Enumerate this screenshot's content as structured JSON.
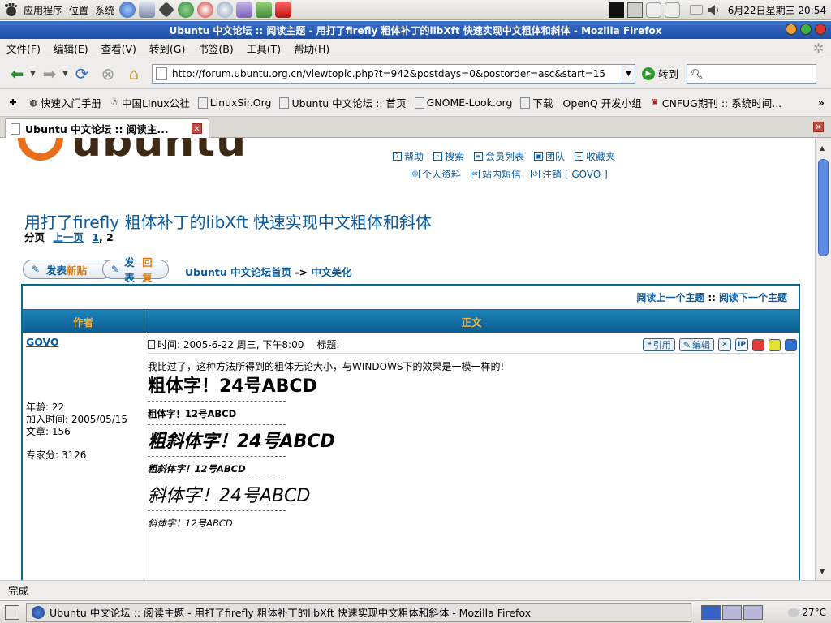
{
  "top_panel": {
    "menus": [
      "应用程序",
      "位置",
      "系统"
    ],
    "clock": "6月22日星期三 20:54"
  },
  "window": {
    "title": "Ubuntu 中文论坛 :: 阅读主题 - 用打了firefly 粗体补丁的libXft 快速实现中文粗体和斜体 - Mozilla Firefox"
  },
  "menubar": {
    "items": [
      "文件(F)",
      "编辑(E)",
      "查看(V)",
      "转到(G)",
      "书签(B)",
      "工具(T)",
      "帮助(H)"
    ]
  },
  "navbar": {
    "url": "http://forum.ubuntu.org.cn/viewtopic.php?t=942&postdays=0&postorder=asc&start=15",
    "go_label": "转到",
    "search_placeholder": ""
  },
  "bookmarks": {
    "items": [
      "快速入门手册",
      "中国Linux公社",
      "LinuxSir.Org",
      "Ubuntu 中文论坛 :: 首页",
      "GNOME-Look.org",
      "下载 | OpenQ 开发小组",
      "CNFUG期刊 :: 系统时间..."
    ],
    "more": "»"
  },
  "tabs": [
    {
      "label": "Ubuntu 中文论坛 :: 阅读主..."
    }
  ],
  "site_nav": {
    "row1": [
      "帮助",
      "搜索",
      "会员列表",
      "团队",
      "收藏夹"
    ],
    "row2": [
      "个人资料",
      "站内短信",
      "注销 [ GOVO ]"
    ]
  },
  "logo_text": "ubuntu",
  "topic": {
    "title": "用打了firefly 粗体补丁的libXft 快速实现中文粗体和斜体",
    "pager_label": "分页",
    "pager_prev": "上一页",
    "pager_page1": "1",
    "pager_sep": ",",
    "pager_current": "2"
  },
  "buttons": {
    "new_topic_a": "发表",
    "new_topic_b": "新贴",
    "reply_a": "发表",
    "reply_b": "回复"
  },
  "breadcrumb": {
    "home": "Ubuntu 中文论坛首页",
    "arrow": "->",
    "forum": "中文美化"
  },
  "post_table": {
    "prev_topic": "阅读上一个主题",
    "sep": "::",
    "next_topic": "阅读下一个主题",
    "col_author": "作者",
    "col_body": "正文"
  },
  "post": {
    "author": "GOVO",
    "age": "年龄: 22",
    "joined": "加入时间: 2005/05/15",
    "posts": "文章: 156",
    "expert": "专家分: 3126",
    "time": "时间: 2005-6-22 周三, 下午8:00",
    "subject_label": "标题:",
    "quote_label": "引用",
    "edit_label": "编辑",
    "delete_label": "✕",
    "ip_label": "IP",
    "intro": "我比过了，这种方法所得到的粗体无论大小，与WINDOWS下的效果是一模一样的!",
    "samples": [
      "粗体字！24号ABCD",
      "粗体字！12号ABCD",
      "粗斜体字！24号ABCD",
      "粗斜体字！12号ABCD",
      "斜体字！24号ABCD",
      "斜体字！12号ABCD"
    ]
  },
  "status": {
    "text": "完成"
  },
  "taskbar": {
    "window_label": "Ubuntu 中文论坛 :: 阅读主题 - 用打了firefly 粗体补丁的libXft 快速实现中文粗体和斜体 - Mozilla Firefox",
    "weather": "27°C"
  },
  "colors": {
    "link": "#0b5a9c",
    "table_border": "#0c6a91",
    "header_text": "#f7b23a",
    "titlebar": "#1e4fa6"
  }
}
